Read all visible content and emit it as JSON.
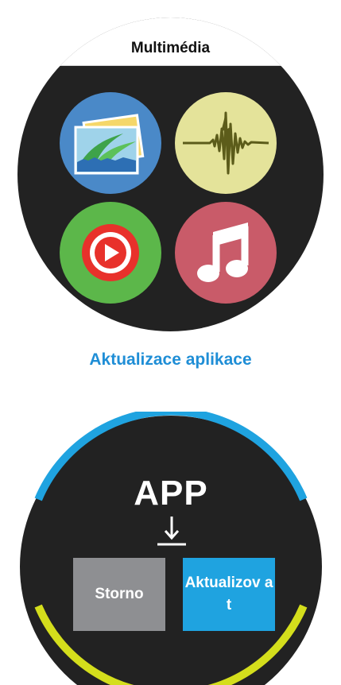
{
  "multimedia": {
    "title": "Multimédia",
    "apps": [
      {
        "icon": "gallery-icon",
        "color": "#4a89c8"
      },
      {
        "icon": "voice-recorder-icon",
        "color": "#e4e39a"
      },
      {
        "icon": "video-player-icon",
        "color": "#5cb74a"
      },
      {
        "icon": "music-icon",
        "color": "#c95b69"
      }
    ]
  },
  "section_heading": "Aktualizace aplikace",
  "update_dialog": {
    "app_label": "APP",
    "icon": "download-icon",
    "cancel_label": "Storno",
    "update_label": "Aktualizov at",
    "colors": {
      "arc_top": "#1fa3e0",
      "arc_bottom": "#d4de1c",
      "cancel": "#8e8f92",
      "update": "#1fa3e0"
    }
  }
}
